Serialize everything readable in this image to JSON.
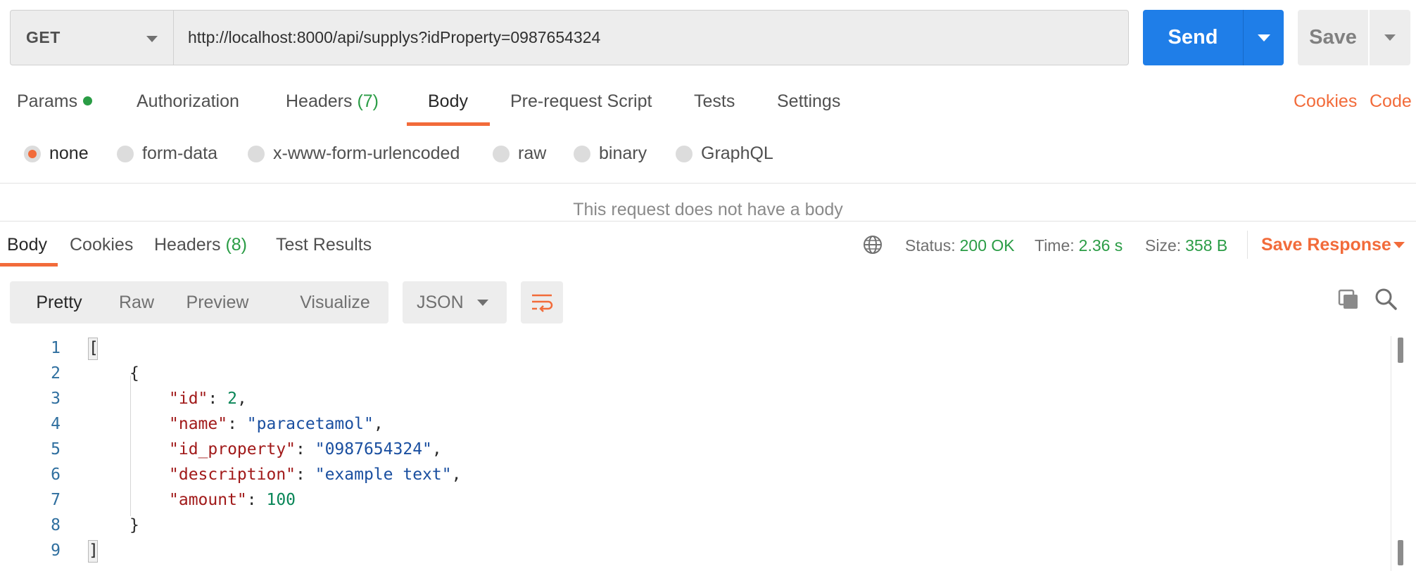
{
  "request": {
    "method": "GET",
    "url": "http://localhost:8000/api/supplys?idProperty=0987654324",
    "send_label": "Send",
    "save_label": "Save"
  },
  "request_tabs": {
    "params": "Params",
    "authorization": "Authorization",
    "headers": "Headers",
    "headers_count": "(7)",
    "body": "Body",
    "pre_request": "Pre-request Script",
    "tests": "Tests",
    "settings": "Settings",
    "active": "Body"
  },
  "links": {
    "cookies": "Cookies",
    "code": "Code"
  },
  "body_types": {
    "none": "none",
    "form_data": "form-data",
    "urlencoded": "x-www-form-urlencoded",
    "raw": "raw",
    "binary": "binary",
    "graphql": "GraphQL",
    "selected": "none"
  },
  "no_body_message": "This request does not have a body",
  "response_tabs": {
    "body": "Body",
    "cookies": "Cookies",
    "headers": "Headers",
    "headers_count": "(8)",
    "test_results": "Test Results",
    "active": "Body"
  },
  "response_meta": {
    "status_label": "Status:",
    "status_value": "200 OK",
    "time_label": "Time:",
    "time_value": "2.36 s",
    "size_label": "Size:",
    "size_value": "358 B",
    "save_response": "Save Response"
  },
  "view_modes": {
    "pretty": "Pretty",
    "raw": "Raw",
    "preview": "Preview",
    "visualize": "Visualize",
    "active": "Pretty",
    "format": "JSON"
  },
  "code": {
    "line_numbers": [
      "1",
      "2",
      "3",
      "4",
      "5",
      "6",
      "7",
      "8",
      "9"
    ],
    "l1": "[",
    "l2": "{",
    "k3": "\"id\"",
    "v3": "2",
    "k4": "\"name\"",
    "v4": "\"paracetamol\"",
    "k5": "\"id_property\"",
    "v5": "\"0987654324\"",
    "k6": "\"description\"",
    "v6": "\"example text\"",
    "k7": "\"amount\"",
    "v7": "100",
    "l8": "}",
    "l9": "]",
    "colon": ": ",
    "comma": ","
  },
  "colors": {
    "accent": "#f26b3a",
    "send_blue": "#1f7ee8",
    "status_green": "#2a9c45"
  },
  "icons": [
    "chevron-down-icon",
    "globe-icon",
    "wrap-lines-icon",
    "copy-icon",
    "search-icon"
  ]
}
